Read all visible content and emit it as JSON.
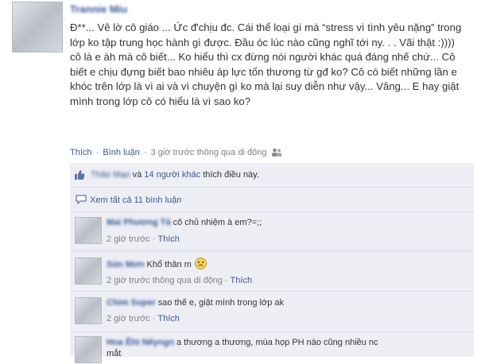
{
  "post": {
    "author": "Trannie Miu",
    "text": "Đ**... Vê lờ cô giáo ... Ức đ'chịu đc. Cái thể loại gì mà “stress vì tình yêu nặng” trong lớp ko tập trung học hành gì được. Đầu óc lúc nào cũng nghĩ tới ny. . . Vãi thật :)))) cô là e àh mà cô biết... Ko hiểu thì cx đừng nói người khác quá đáng nhế chứ... Cô biết e chịu đựng biết bao nhiêu áp lực tổn thương từ gđ ko? Cô có biết những lần e khóc trên lớp là vì ai và vì chuyện gì ko mà lại suy diễn như vậy... Vâng... E hay giật mình trong lớp cô có hiểu là vì sao ko?",
    "like_label": "Thích",
    "comment_label": "Bình luận",
    "time_text": "3 giờ trước thông qua di động",
    "separator": "·"
  },
  "likes": {
    "first_name": "Thảo Mạo",
    "connector": "và",
    "others": "14 người khác",
    "suffix": "thích điều này."
  },
  "view_all": "Xem tất cả 11 bình luận",
  "comments": [
    {
      "name": "Mai Phương Tả",
      "text": "cô chủ nhiệm à em?=;;",
      "time": "2 giờ trước",
      "like": "Thích"
    },
    {
      "name": "Sún Mơn",
      "text": "Khổ thân m",
      "time": "2 giờ trước thông qua di động",
      "like": "Thích"
    },
    {
      "name": "Chim Super",
      "text": "sao thế e, giật mình trong lớp ak",
      "time": "2 giờ trước",
      "like": "Thích"
    },
    {
      "name": "Hna Ěht Nếyngn",
      "text": "a thương a thương, mùa họp PH nào cũng nhiều nc",
      "text2": "mắt"
    }
  ],
  "colors": {
    "link": "#3b5998",
    "feedback_bg": "#edeff4",
    "meta": "#808080"
  }
}
